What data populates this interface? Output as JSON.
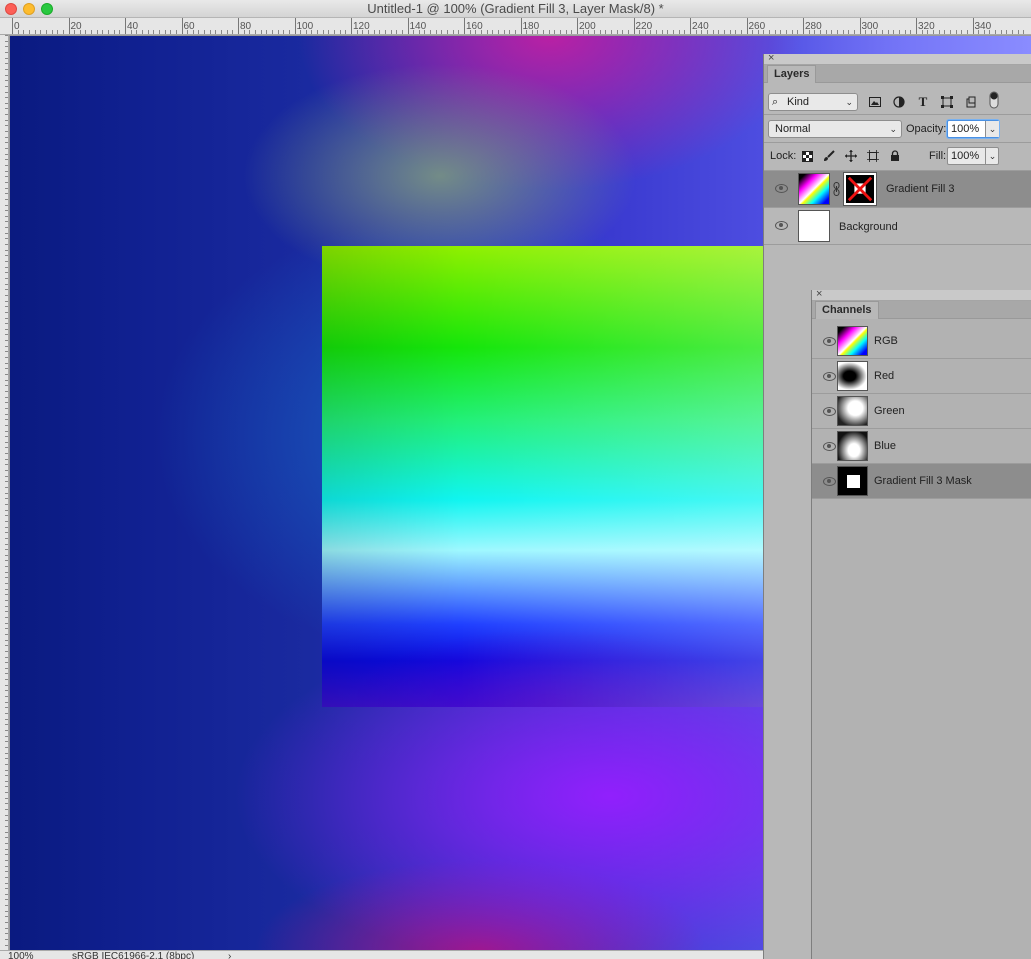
{
  "window": {
    "title": "Untitled-1 @ 100% (Gradient Fill 3, Layer Mask/8) *"
  },
  "ruler": {
    "labels": [
      "0",
      "20",
      "40",
      "60",
      "80",
      "100",
      "120",
      "140",
      "160",
      "180",
      "200",
      "220",
      "240",
      "260",
      "280",
      "300",
      "320",
      "340"
    ]
  },
  "status": {
    "zoom": "100%",
    "profile": "sRGB IEC61966-2.1 (8bpc)",
    "arrow": "›"
  },
  "layers_panel": {
    "close": "×",
    "tab": "Layers",
    "filter": {
      "search_icon": "⌕",
      "value": "Kind",
      "chevron": "⌄"
    },
    "blend_mode": {
      "value": "Normal",
      "chevron": "⌄"
    },
    "opacity": {
      "label": "Opacity:",
      "value": "100%",
      "chevron": "⌄"
    },
    "lock": {
      "label": "Lock:"
    },
    "fill": {
      "label": "Fill:",
      "value": "100%",
      "chevron": "⌄"
    },
    "filter_icons": {
      "text_glyph": "T"
    },
    "layers": [
      {
        "name": "Gradient Fill 3",
        "selected": true
      },
      {
        "name": "Background",
        "selected": false
      }
    ]
  },
  "channels_panel": {
    "close": "×",
    "tab": "Channels",
    "channels": [
      {
        "name": "RGB"
      },
      {
        "name": "Red"
      },
      {
        "name": "Green"
      },
      {
        "name": "Blue"
      },
      {
        "name": "Gradient Fill 3 Mask",
        "selected": true
      }
    ]
  }
}
